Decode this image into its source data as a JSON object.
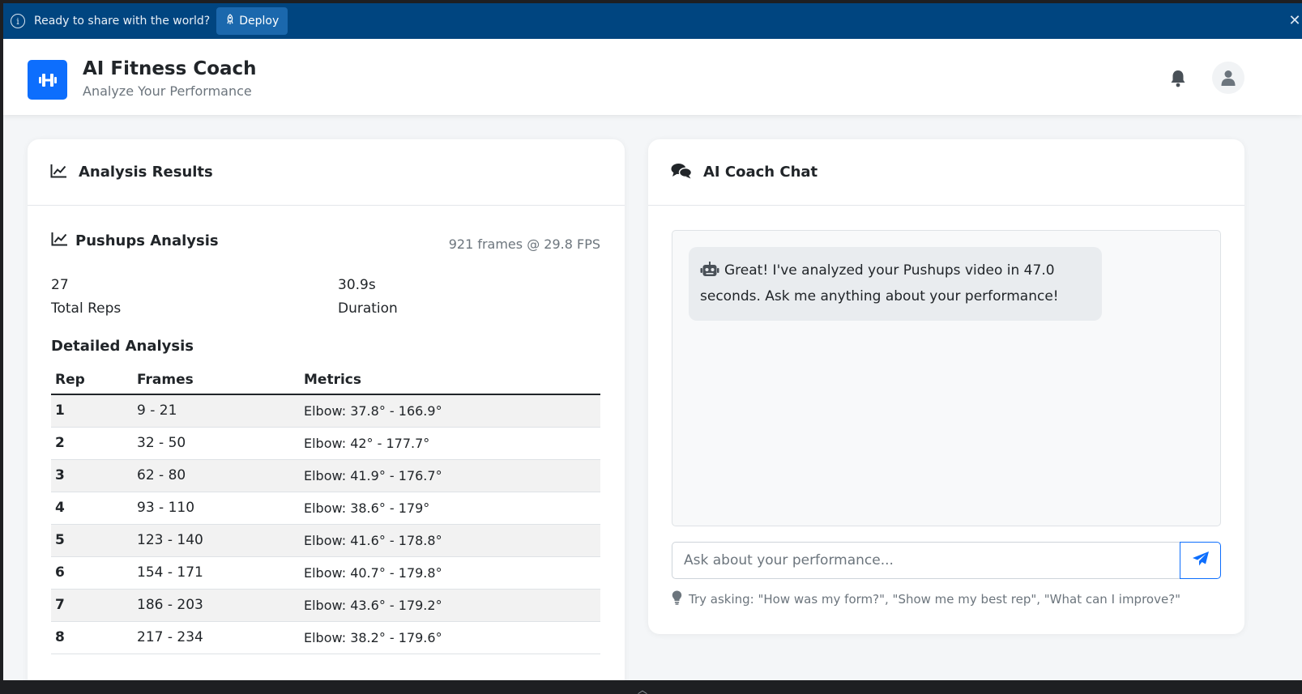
{
  "banner": {
    "message": "Ready to share with the world?",
    "deploy_label": "Deploy"
  },
  "header": {
    "title": "AI Fitness Coach",
    "subtitle": "Analyze Your Performance"
  },
  "analysis": {
    "card_title": "Analysis Results",
    "section_title": "Pushups Analysis",
    "frames_info": "921 frames @ 29.8 FPS",
    "total_reps_value": "27",
    "total_reps_label": "Total Reps",
    "duration_value": "30.9s",
    "duration_label": "Duration",
    "detailed_title": "Detailed Analysis",
    "columns": [
      "Rep",
      "Frames",
      "Metrics"
    ],
    "rows": [
      {
        "rep": "1",
        "frames": "9 - 21",
        "metrics": "Elbow: 37.8° - 166.9°"
      },
      {
        "rep": "2",
        "frames": "32 - 50",
        "metrics": "Elbow: 42° - 177.7°"
      },
      {
        "rep": "3",
        "frames": "62 - 80",
        "metrics": "Elbow: 41.9° - 176.7°"
      },
      {
        "rep": "4",
        "frames": "93 - 110",
        "metrics": "Elbow: 38.6° - 179°"
      },
      {
        "rep": "5",
        "frames": "123 - 140",
        "metrics": "Elbow: 41.6° - 178.8°"
      },
      {
        "rep": "6",
        "frames": "154 - 171",
        "metrics": "Elbow: 40.7° - 179.8°"
      },
      {
        "rep": "7",
        "frames": "186 - 203",
        "metrics": "Elbow: 43.6° - 179.2°"
      },
      {
        "rep": "8",
        "frames": "217 - 234",
        "metrics": "Elbow: 38.2° - 179.6°"
      }
    ]
  },
  "chat": {
    "card_title": "AI Coach Chat",
    "bot_message": "Great! I've analyzed your Pushups video in 47.0 seconds. Ask me anything about your performance!",
    "input_placeholder": "Ask about your performance...",
    "hint": "Try asking: \"How was my form?\", \"Show me my best rep\", \"What can I improve?\""
  },
  "icons": {
    "info": "info-icon",
    "deploy": "rocket-icon",
    "close": "close-icon",
    "logo": "dumbbell-icon",
    "bell": "bell-icon",
    "avatar": "user-icon",
    "chart": "line-chart-icon",
    "chat": "comments-icon",
    "bot": "robot-icon",
    "send": "paper-plane-icon",
    "hint": "lightbulb-icon"
  },
  "colors": {
    "banner_bg": "#004580",
    "accent": "#0d6efd"
  }
}
